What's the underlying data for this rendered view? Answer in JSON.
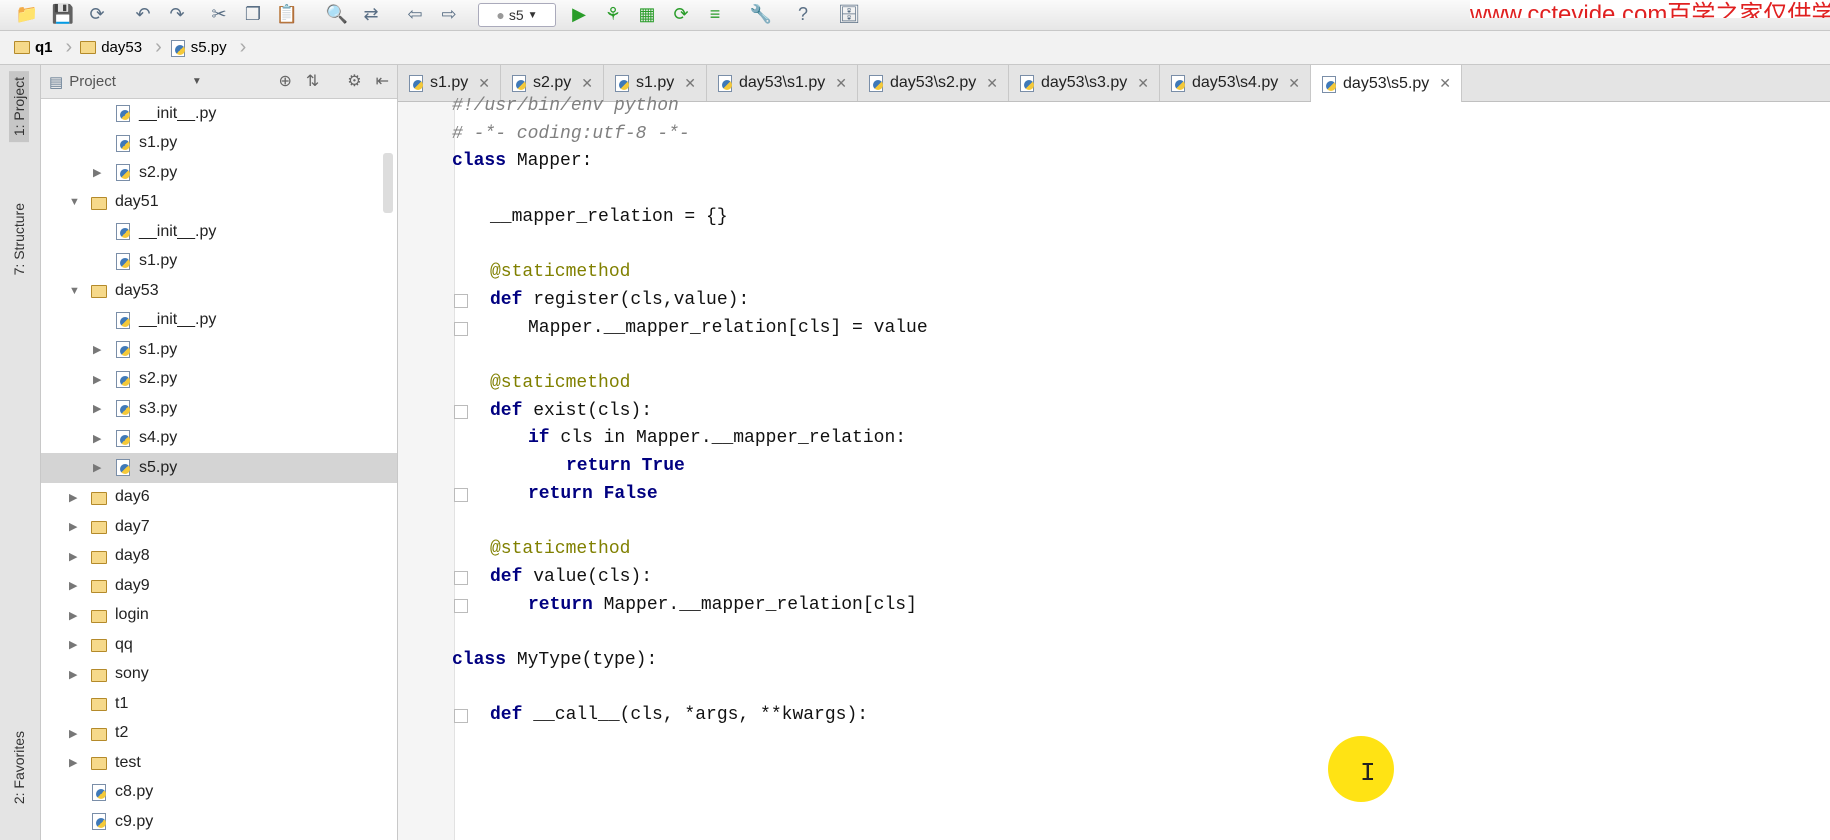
{
  "toolbar": {
    "run_config": "s5",
    "watermark": "www.cctevide.com百学之家仅供学"
  },
  "breadcrumb": [
    "q1",
    "day53",
    "s5.py"
  ],
  "side_tabs": {
    "project": "1: Project",
    "structure": "7: Structure",
    "favorites": "2: Favorites"
  },
  "project_panel": {
    "title": "Project",
    "items": [
      {
        "label": "__init__.py",
        "type": "py",
        "depth": 2
      },
      {
        "label": "s1.py",
        "type": "py",
        "depth": 2
      },
      {
        "label": "s2.py",
        "type": "py",
        "depth": 2,
        "expandable": true
      },
      {
        "label": "day51",
        "type": "folder",
        "depth": 1,
        "expanded": true
      },
      {
        "label": "__init__.py",
        "type": "py",
        "depth": 2
      },
      {
        "label": "s1.py",
        "type": "py",
        "depth": 2
      },
      {
        "label": "day53",
        "type": "folder",
        "depth": 1,
        "expanded": true
      },
      {
        "label": "__init__.py",
        "type": "py",
        "depth": 2
      },
      {
        "label": "s1.py",
        "type": "py",
        "depth": 2,
        "expandable": true
      },
      {
        "label": "s2.py",
        "type": "py",
        "depth": 2,
        "expandable": true
      },
      {
        "label": "s3.py",
        "type": "py",
        "depth": 2,
        "expandable": true
      },
      {
        "label": "s4.py",
        "type": "py",
        "depth": 2,
        "expandable": true
      },
      {
        "label": "s5.py",
        "type": "py",
        "depth": 2,
        "expandable": true,
        "selected": true
      },
      {
        "label": "day6",
        "type": "folder",
        "depth": 1,
        "expandable": true
      },
      {
        "label": "day7",
        "type": "folder",
        "depth": 1,
        "expandable": true
      },
      {
        "label": "day8",
        "type": "folder",
        "depth": 1,
        "expandable": true
      },
      {
        "label": "day9",
        "type": "folder",
        "depth": 1,
        "expandable": true
      },
      {
        "label": "login",
        "type": "folder",
        "depth": 1,
        "expandable": true
      },
      {
        "label": "qq",
        "type": "folder",
        "depth": 1,
        "expandable": true
      },
      {
        "label": "sony",
        "type": "folder",
        "depth": 1,
        "expandable": true
      },
      {
        "label": "t1",
        "type": "folder",
        "depth": 1
      },
      {
        "label": "t2",
        "type": "folder",
        "depth": 1,
        "expandable": true
      },
      {
        "label": "test",
        "type": "folder",
        "depth": 1,
        "expandable": true
      },
      {
        "label": "c8.py",
        "type": "py",
        "depth": 1
      },
      {
        "label": "c9.py",
        "type": "py",
        "depth": 1
      }
    ]
  },
  "editor_tabs": [
    {
      "label": "s1.py"
    },
    {
      "label": "s2.py"
    },
    {
      "label": "s1.py"
    },
    {
      "label": "day53\\s1.py"
    },
    {
      "label": "day53\\s2.py"
    },
    {
      "label": "day53\\s3.py"
    },
    {
      "label": "day53\\s4.py"
    },
    {
      "label": "day53\\s5.py",
      "active": true
    }
  ],
  "code_lines": [
    {
      "text": "#!/usr/bin/env python",
      "indent": 0,
      "style": "comment"
    },
    {
      "text": "# -*- coding:utf-8 -*-",
      "indent": 0,
      "style": "comment"
    },
    {
      "kw": "class",
      "text": " Mapper:",
      "indent": 0
    },
    {
      "text": "",
      "indent": 0
    },
    {
      "text": "__mapper_relation = {}",
      "indent": 1
    },
    {
      "text": "",
      "indent": 0
    },
    {
      "text": "@staticmethod",
      "indent": 1,
      "style": "decorator"
    },
    {
      "kw": "def",
      "text": " register(cls,value):",
      "indent": 1
    },
    {
      "text": "Mapper.__mapper_relation[cls] = value",
      "indent": 2
    },
    {
      "text": "",
      "indent": 0
    },
    {
      "text": "@staticmethod",
      "indent": 1,
      "style": "decorator"
    },
    {
      "kw": "def",
      "text": " exist(cls):",
      "indent": 1
    },
    {
      "kw": "if",
      "text": " cls in Mapper.__mapper_relation:",
      "indent": 2
    },
    {
      "kw": "return True",
      "text": "",
      "indent": 3
    },
    {
      "kw": "return False",
      "text": "",
      "indent": 2
    },
    {
      "text": "",
      "indent": 0
    },
    {
      "text": "@staticmethod",
      "indent": 1,
      "style": "decorator"
    },
    {
      "kw": "def",
      "text": " value(cls):",
      "indent": 1
    },
    {
      "kw": "return",
      "text": " Mapper.__mapper_relation[cls]",
      "indent": 2
    },
    {
      "text": "",
      "indent": 0
    },
    {
      "kw": "class",
      "text": " MyType(type):",
      "indent": 0
    },
    {
      "text": "",
      "indent": 0
    },
    {
      "kw": "def",
      "text": " __call__(cls, *args, **kwargs):",
      "indent": 1
    }
  ]
}
